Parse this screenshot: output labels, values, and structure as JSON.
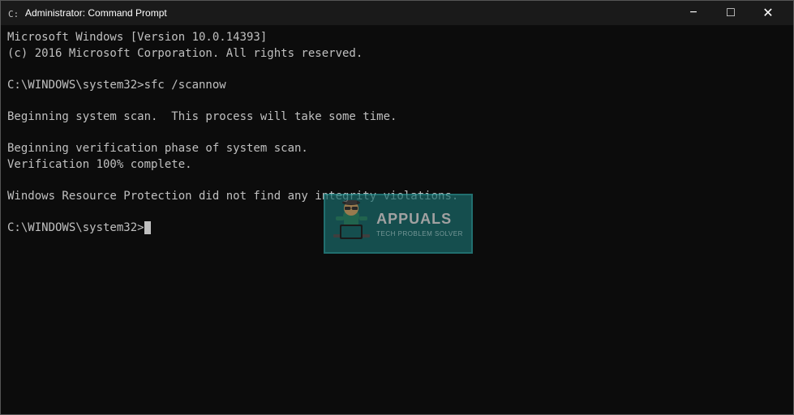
{
  "window": {
    "title": "Administrator: Command Prompt",
    "icon": "cmd-icon"
  },
  "titlebar": {
    "minimize_label": "−",
    "maximize_label": "□",
    "close_label": "✕"
  },
  "console": {
    "lines": [
      "Microsoft Windows [Version 10.0.14393]",
      "(c) 2016 Microsoft Corporation. All rights reserved.",
      "",
      "C:\\WINDOWS\\system32>sfc /scannow",
      "",
      "Beginning system scan.  This process will take some time.",
      "",
      "Beginning verification phase of system scan.",
      "Verification 100% complete.",
      "",
      "Windows Resource Protection did not find any integrity violations.",
      "",
      "C:\\WINDOWS\\system32>"
    ],
    "prompt": "C:\\WINDOWS\\system32>"
  },
  "watermark": {
    "brand": "APPUALS",
    "sub": "TECH PROBLEM SOLVER"
  }
}
